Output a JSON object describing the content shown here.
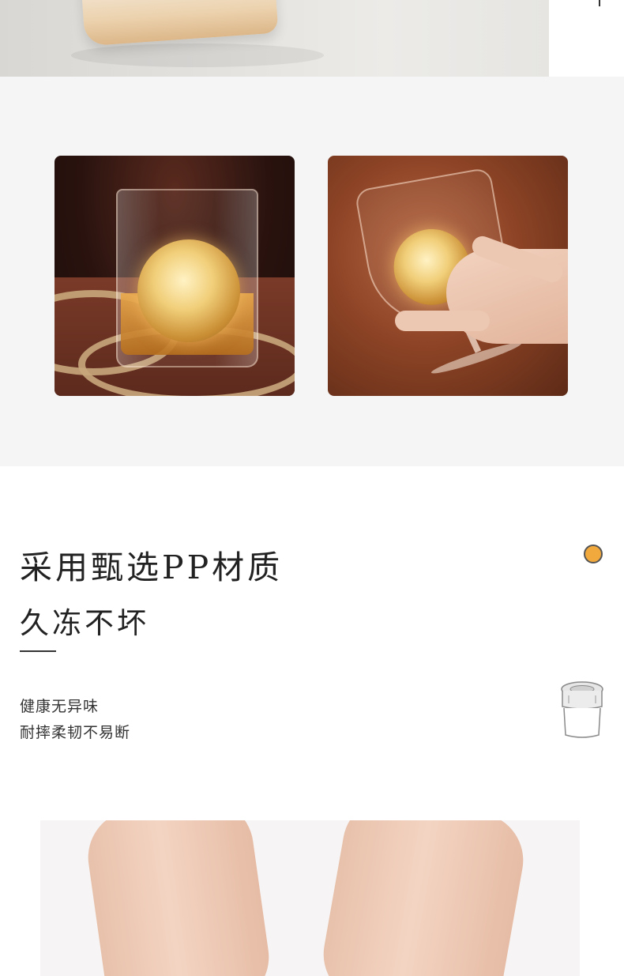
{
  "headline": {
    "line1": "采用甄选PP材质",
    "line2": "久冻不坏"
  },
  "features": [
    "健康无异味",
    "耐摔柔韧不易断"
  ],
  "colors": {
    "accent_dot": "#f1a93d",
    "section_background": "#f5f5f5",
    "text": "#222222"
  },
  "icons": {
    "badge": "orange-dot-icon",
    "product": "ice-mold-cup-icon"
  }
}
